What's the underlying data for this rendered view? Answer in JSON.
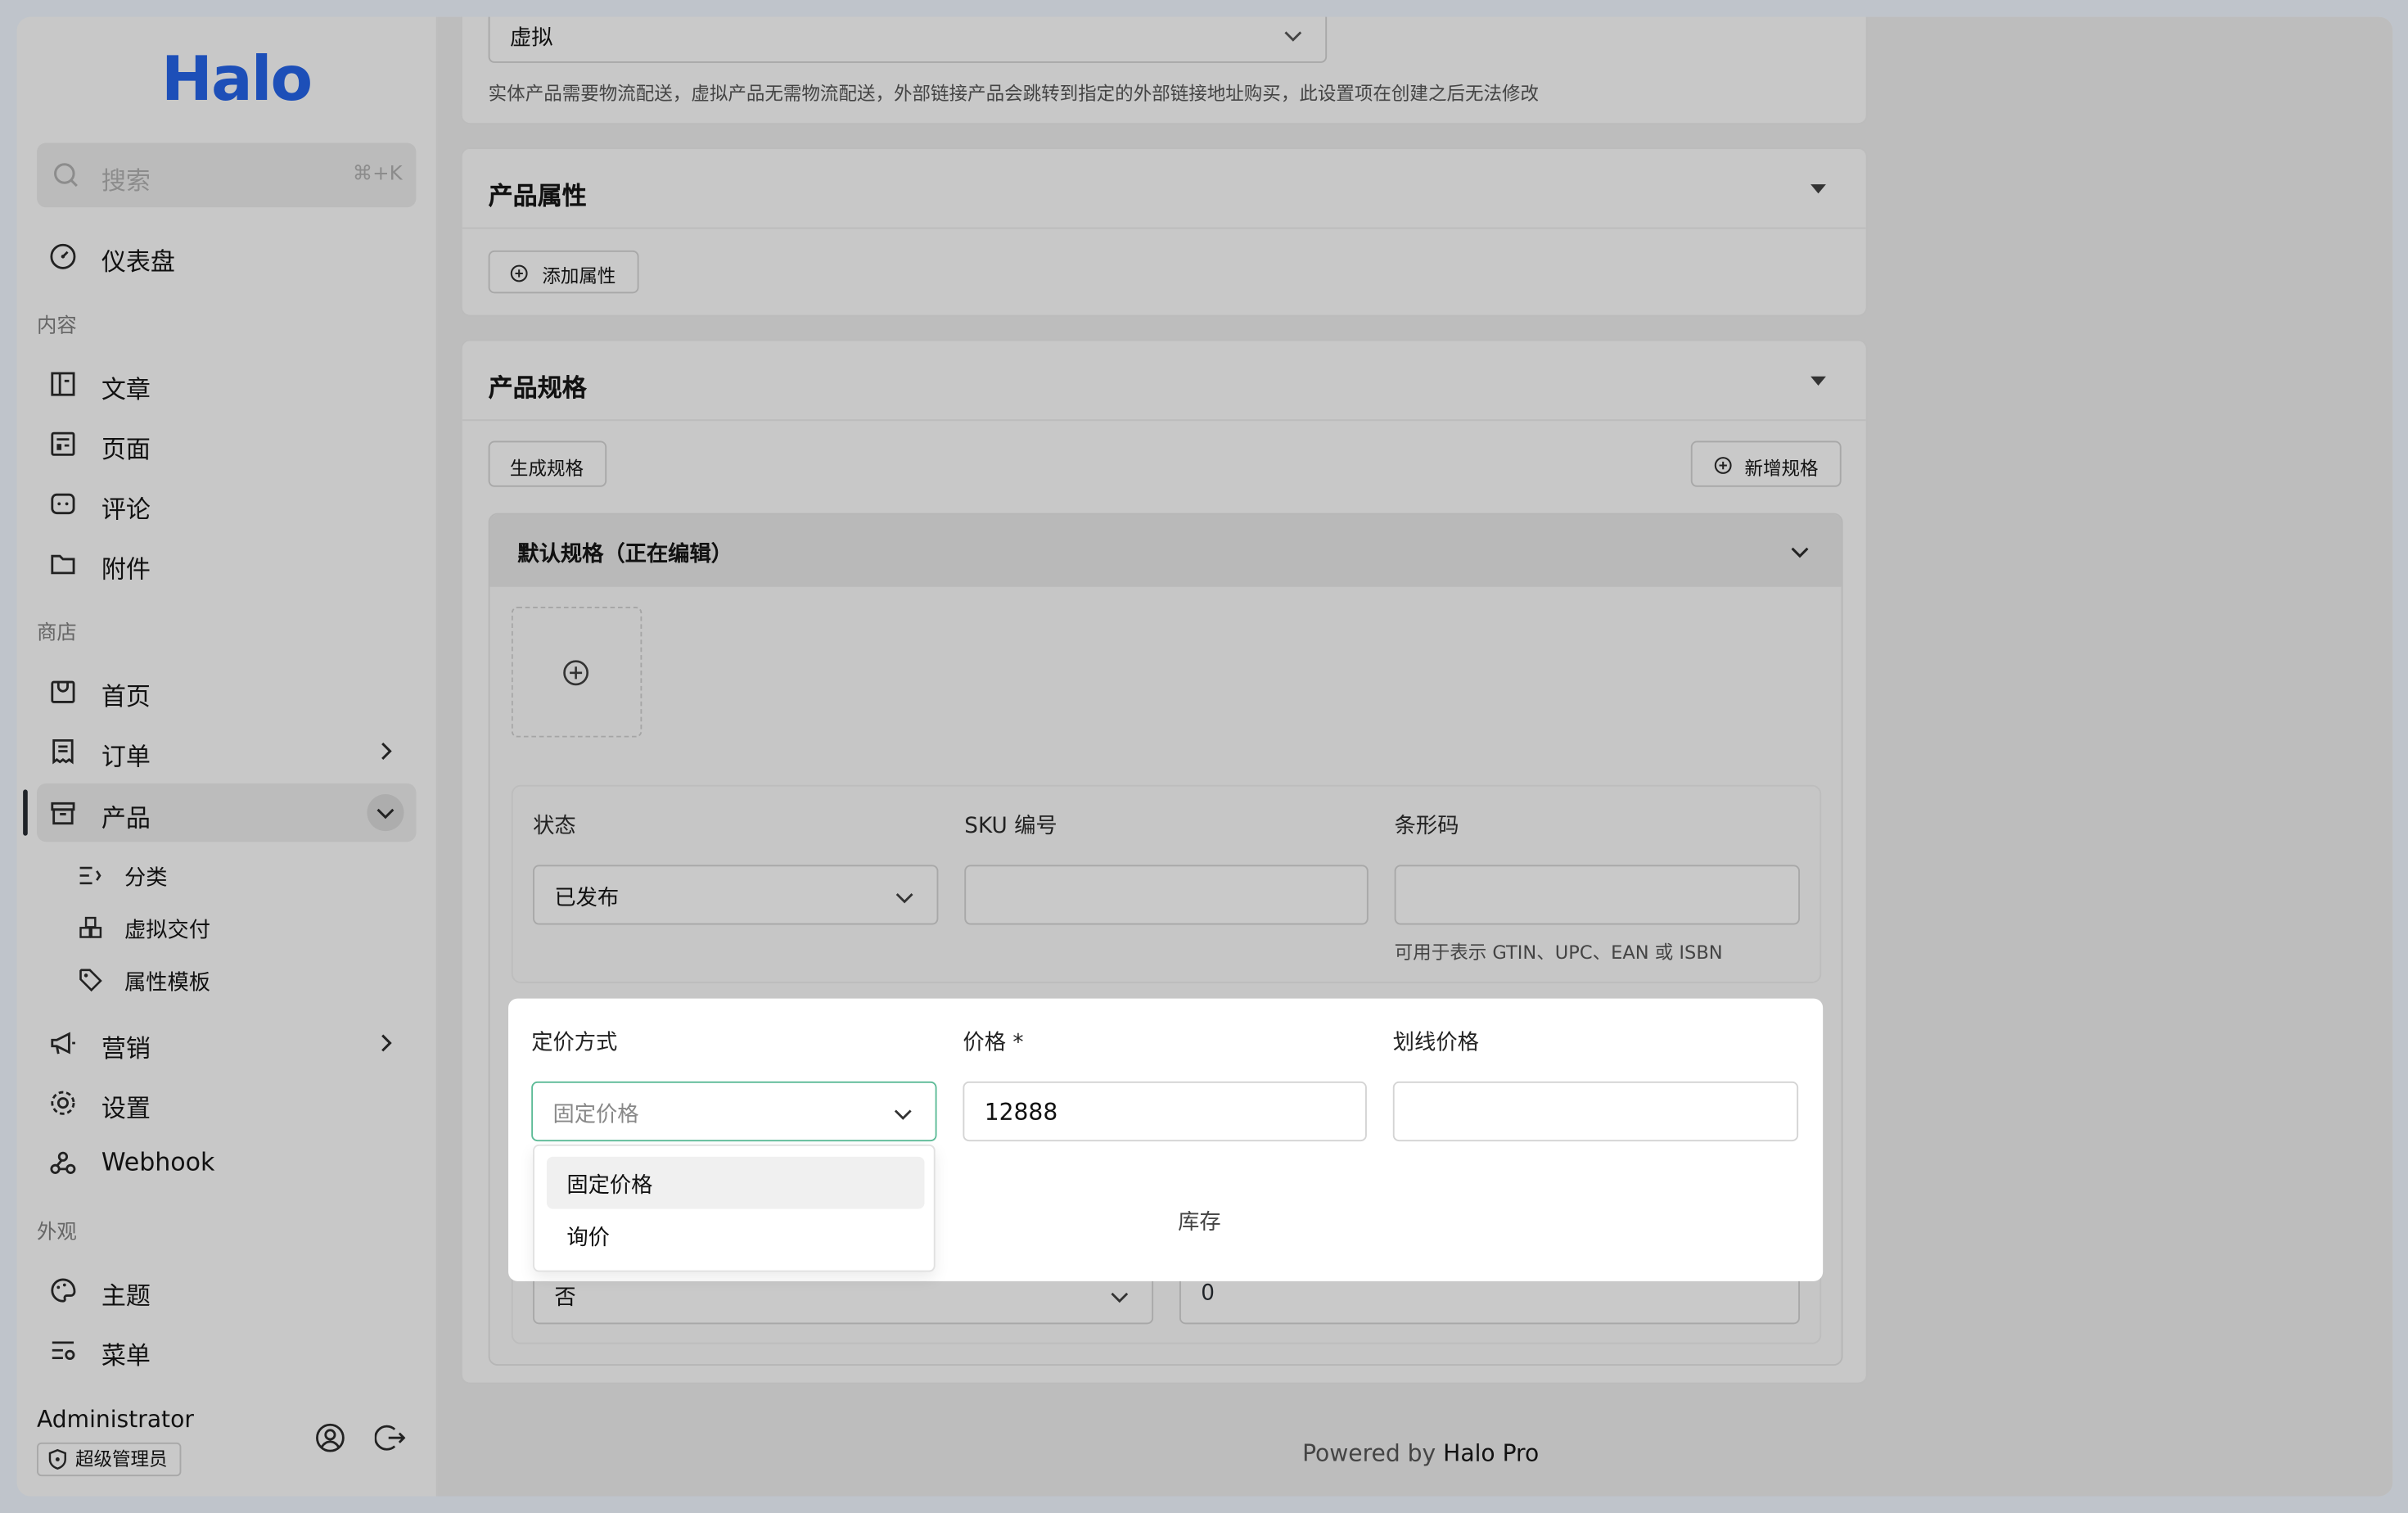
{
  "app": {
    "logo": "Halo"
  },
  "search": {
    "placeholder": "搜索",
    "shortcut": "⌘+K"
  },
  "sidebar": {
    "dashboard": "仪表盘",
    "groups": {
      "content": "内容",
      "shop": "商店",
      "appearance": "外观"
    },
    "content_items": [
      "文章",
      "页面",
      "评论",
      "附件"
    ],
    "shop_items": {
      "home": "首页",
      "orders": "订单",
      "products": "产品",
      "marketing": "营销",
      "settings": "设置",
      "webhook": "Webhook"
    },
    "product_sub": [
      "分类",
      "虚拟交付",
      "属性模板"
    ],
    "appearance_items": [
      "主题",
      "菜单"
    ],
    "user": {
      "name": "Administrator",
      "role": "超级管理员"
    }
  },
  "top_card": {
    "type_value": "虚拟",
    "type_hint": "实体产品需要物流配送，虚拟产品无需物流配送，外部链接产品会跳转到指定的外部链接地址购买，此设置项在创建之后无法修改"
  },
  "attributes_card": {
    "title": "产品属性",
    "add_button": "添加属性"
  },
  "spec_card": {
    "title": "产品规格",
    "generate_button": "生成规格",
    "new_button": "新增规格",
    "default_spec": {
      "title": "默认规格（正在编辑）",
      "status_label": "状态",
      "status_value": "已发布",
      "sku_label": "SKU 编号",
      "sku_value": "",
      "barcode_label": "条形码",
      "barcode_value": "",
      "barcode_hint": "可用于表示 GTIN、UPC、EAN 或 ISBN",
      "pricing_label": "定价方式",
      "pricing_value": "固定价格",
      "price_label": "价格 *",
      "price_value": "12888",
      "strike_label": "划线价格",
      "strike_value": "",
      "stock_label": "库存",
      "stock_value": "0",
      "track_value": "否",
      "pricing_options": [
        "固定价格",
        "询价"
      ]
    }
  },
  "footer": {
    "prefix": "Powered by ",
    "brand": "Halo Pro"
  }
}
